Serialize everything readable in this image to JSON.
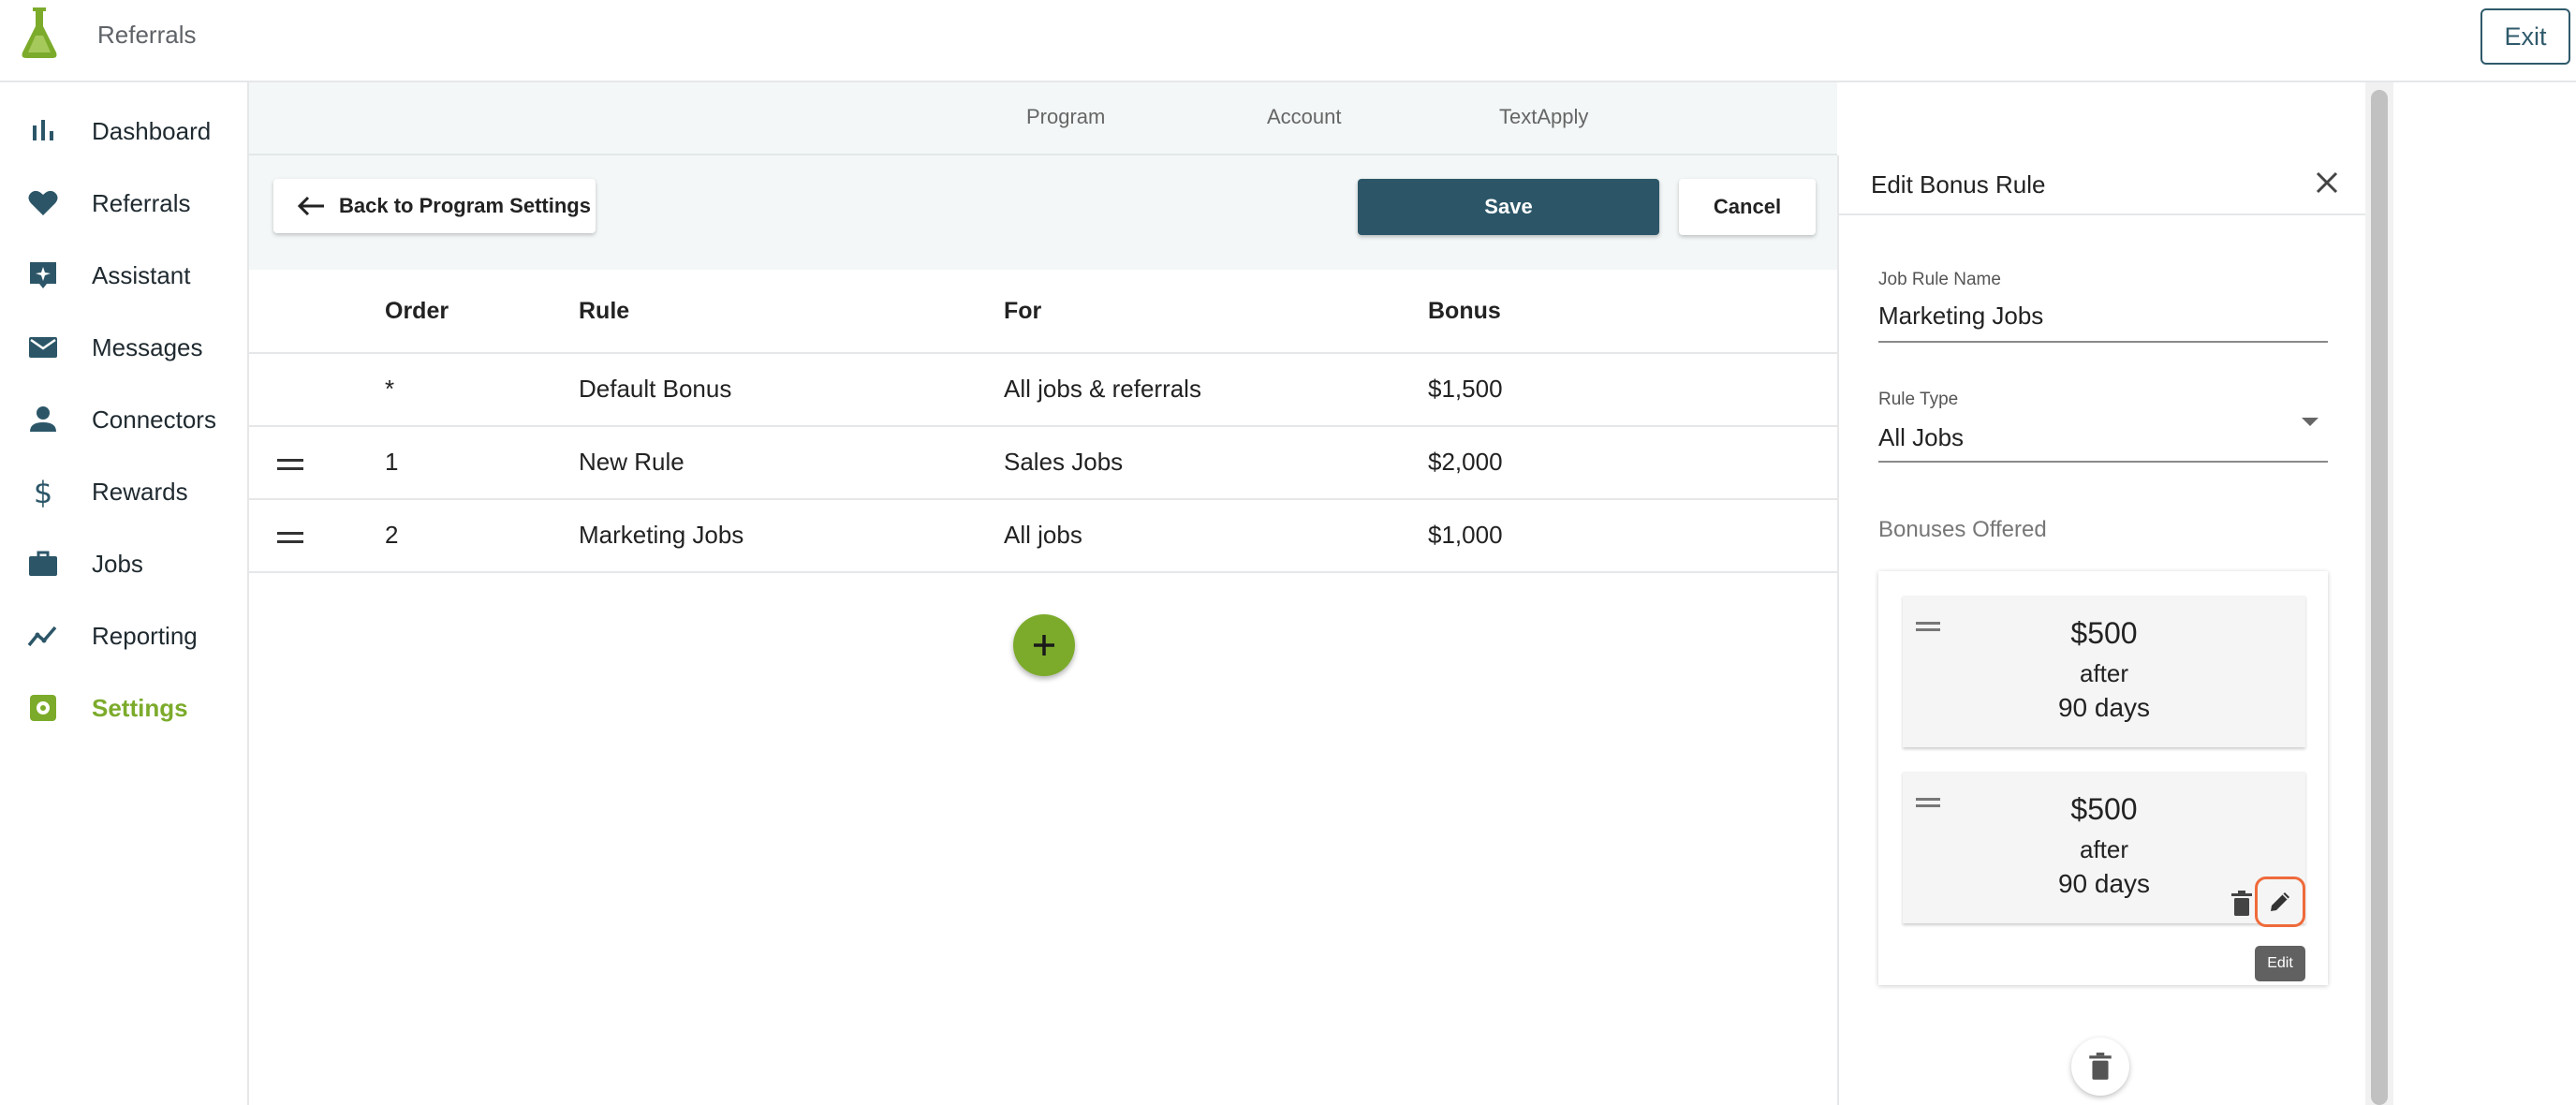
{
  "app": {
    "title": "Referrals",
    "exit_label": "Exit"
  },
  "sidebar": {
    "items": [
      {
        "label": "Dashboard",
        "icon": "bar-chart-icon",
        "active": false
      },
      {
        "label": "Referrals",
        "icon": "heart-icon",
        "active": false
      },
      {
        "label": "Assistant",
        "icon": "assistant-icon",
        "active": false
      },
      {
        "label": "Messages",
        "icon": "mail-icon",
        "active": false
      },
      {
        "label": "Connectors",
        "icon": "person-icon",
        "active": false
      },
      {
        "label": "Rewards",
        "icon": "dollar-icon",
        "active": false
      },
      {
        "label": "Jobs",
        "icon": "briefcase-icon",
        "active": false
      },
      {
        "label": "Reporting",
        "icon": "trending-icon",
        "active": false
      },
      {
        "label": "Settings",
        "icon": "gear-icon",
        "active": true
      }
    ]
  },
  "tabs": [
    "Program",
    "Account",
    "TextApply"
  ],
  "toolbar": {
    "back_label": "Back to Program Settings",
    "save_label": "Save",
    "cancel_label": "Cancel"
  },
  "table": {
    "headers": [
      "Order",
      "Rule",
      "For",
      "Bonus"
    ],
    "rows": [
      {
        "order": "*",
        "rule": "Default Bonus",
        "for": "All jobs & referrals",
        "bonus": "$1,500",
        "draggable": false
      },
      {
        "order": "1",
        "rule": "New Rule",
        "for": "Sales Jobs",
        "bonus": "$2,000",
        "draggable": true
      },
      {
        "order": "2",
        "rule": "Marketing Jobs",
        "for": "All jobs",
        "bonus": "$1,000",
        "draggable": true
      }
    ]
  },
  "panel": {
    "title": "Edit Bonus Rule",
    "job_rule_name_label": "Job Rule Name",
    "job_rule_name_value": "Marketing Jobs",
    "rule_type_label": "Rule Type",
    "rule_type_value": "All Jobs",
    "bonuses_label": "Bonuses Offered",
    "bonuses": [
      {
        "amount": "$500",
        "after": "after",
        "days": "90 days"
      },
      {
        "amount": "$500",
        "after": "after",
        "days": "90 days"
      }
    ],
    "tooltip": "Edit"
  },
  "colors": {
    "brand_green": "#7cab2b",
    "primary_dark": "#2c5668",
    "highlight": "#ef6a3a"
  }
}
